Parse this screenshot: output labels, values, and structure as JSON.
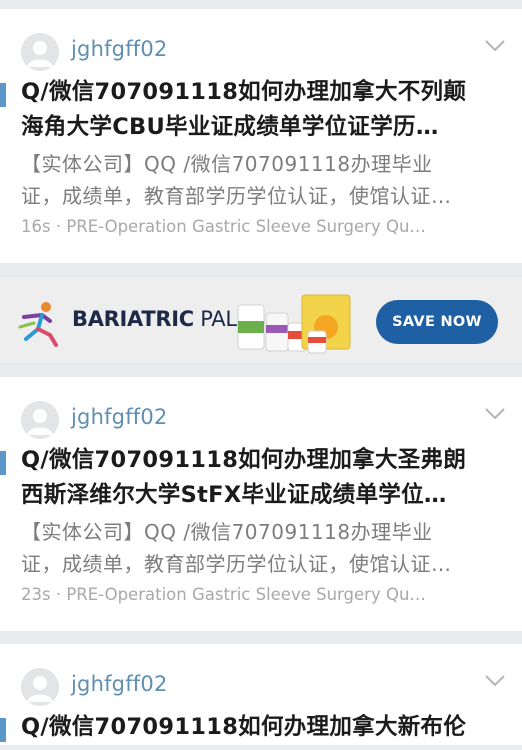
{
  "posts": [
    {
      "username": "jghfgff02",
      "title_line1": "Q/微信707091118如何办理加拿大不列颠",
      "title_line2": "海角大学CBU毕业证成绩单学位证学历…",
      "body_line1": "【实体公司】QQ /微信707091118办理毕业",
      "body_line2": "证，成绩单，教育部学历学位认证，使馆认证…",
      "time": "16s",
      "topic": "· PRE-Operation Gastric Sleeve Surgery Qu…"
    },
    {
      "username": "jghfgff02",
      "title_line1": "Q/微信707091118如何办理加拿大圣弗朗",
      "title_line2": "西斯泽维尔大学StFX毕业证成绩单学位…",
      "body_line1": "【实体公司】QQ /微信707091118办理毕业",
      "body_line2": "证，成绩单，教育部学历学位认证，使馆认证…",
      "time": "23s",
      "topic": "· PRE-Operation Gastric Sleeve Surgery Qu…"
    },
    {
      "username": "jghfgff02",
      "title_line1": "Q/微信707091118如何办理加拿大新布伦"
    }
  ],
  "ad": {
    "brand_bold": "BARIATRIC",
    "brand_light": " PAL",
    "cta": "SAVE NOW",
    "cta_color": "#1f5fa3",
    "logo_icon": "runner-figure-icon"
  },
  "colors": {
    "username": "#5f8fb1",
    "title_bar": "#5c97c9",
    "background": "#e9ecef"
  }
}
